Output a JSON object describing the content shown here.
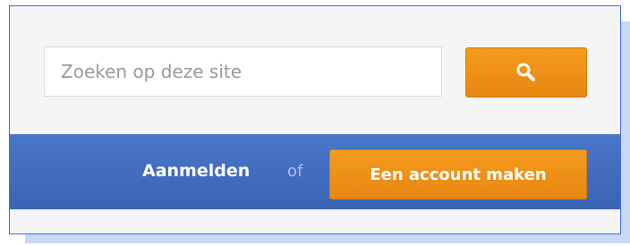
{
  "search": {
    "placeholder": "Zoeken op deze site",
    "button_icon": "search-icon"
  },
  "auth": {
    "login_label": "Aanmelden",
    "or_label": "of",
    "signup_label": "Een account maken"
  },
  "colors": {
    "accent": "#f08f16",
    "bar": "#416dc0",
    "border": "#3f6ed8"
  }
}
